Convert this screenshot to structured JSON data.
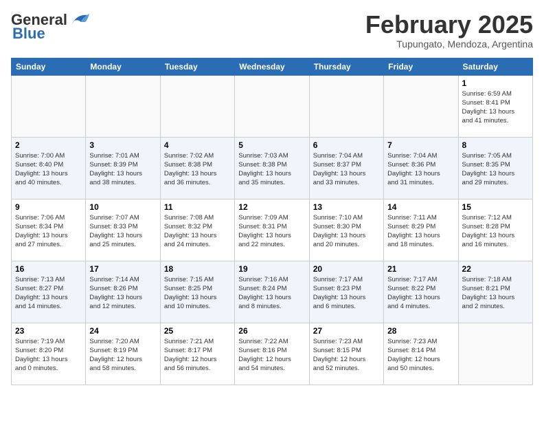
{
  "header": {
    "logo_general": "General",
    "logo_blue": "Blue",
    "title": "February 2025",
    "subtitle": "Tupungato, Mendoza, Argentina"
  },
  "days_of_week": [
    "Sunday",
    "Monday",
    "Tuesday",
    "Wednesday",
    "Thursday",
    "Friday",
    "Saturday"
  ],
  "weeks": [
    {
      "days": [
        {
          "num": "",
          "info": ""
        },
        {
          "num": "",
          "info": ""
        },
        {
          "num": "",
          "info": ""
        },
        {
          "num": "",
          "info": ""
        },
        {
          "num": "",
          "info": ""
        },
        {
          "num": "",
          "info": ""
        },
        {
          "num": "1",
          "info": "Sunrise: 6:59 AM\nSunset: 8:41 PM\nDaylight: 13 hours\nand 41 minutes."
        }
      ]
    },
    {
      "days": [
        {
          "num": "2",
          "info": "Sunrise: 7:00 AM\nSunset: 8:40 PM\nDaylight: 13 hours\nand 40 minutes."
        },
        {
          "num": "3",
          "info": "Sunrise: 7:01 AM\nSunset: 8:39 PM\nDaylight: 13 hours\nand 38 minutes."
        },
        {
          "num": "4",
          "info": "Sunrise: 7:02 AM\nSunset: 8:38 PM\nDaylight: 13 hours\nand 36 minutes."
        },
        {
          "num": "5",
          "info": "Sunrise: 7:03 AM\nSunset: 8:38 PM\nDaylight: 13 hours\nand 35 minutes."
        },
        {
          "num": "6",
          "info": "Sunrise: 7:04 AM\nSunset: 8:37 PM\nDaylight: 13 hours\nand 33 minutes."
        },
        {
          "num": "7",
          "info": "Sunrise: 7:04 AM\nSunset: 8:36 PM\nDaylight: 13 hours\nand 31 minutes."
        },
        {
          "num": "8",
          "info": "Sunrise: 7:05 AM\nSunset: 8:35 PM\nDaylight: 13 hours\nand 29 minutes."
        }
      ]
    },
    {
      "days": [
        {
          "num": "9",
          "info": "Sunrise: 7:06 AM\nSunset: 8:34 PM\nDaylight: 13 hours\nand 27 minutes."
        },
        {
          "num": "10",
          "info": "Sunrise: 7:07 AM\nSunset: 8:33 PM\nDaylight: 13 hours\nand 25 minutes."
        },
        {
          "num": "11",
          "info": "Sunrise: 7:08 AM\nSunset: 8:32 PM\nDaylight: 13 hours\nand 24 minutes."
        },
        {
          "num": "12",
          "info": "Sunrise: 7:09 AM\nSunset: 8:31 PM\nDaylight: 13 hours\nand 22 minutes."
        },
        {
          "num": "13",
          "info": "Sunrise: 7:10 AM\nSunset: 8:30 PM\nDaylight: 13 hours\nand 20 minutes."
        },
        {
          "num": "14",
          "info": "Sunrise: 7:11 AM\nSunset: 8:29 PM\nDaylight: 13 hours\nand 18 minutes."
        },
        {
          "num": "15",
          "info": "Sunrise: 7:12 AM\nSunset: 8:28 PM\nDaylight: 13 hours\nand 16 minutes."
        }
      ]
    },
    {
      "days": [
        {
          "num": "16",
          "info": "Sunrise: 7:13 AM\nSunset: 8:27 PM\nDaylight: 13 hours\nand 14 minutes."
        },
        {
          "num": "17",
          "info": "Sunrise: 7:14 AM\nSunset: 8:26 PM\nDaylight: 13 hours\nand 12 minutes."
        },
        {
          "num": "18",
          "info": "Sunrise: 7:15 AM\nSunset: 8:25 PM\nDaylight: 13 hours\nand 10 minutes."
        },
        {
          "num": "19",
          "info": "Sunrise: 7:16 AM\nSunset: 8:24 PM\nDaylight: 13 hours\nand 8 minutes."
        },
        {
          "num": "20",
          "info": "Sunrise: 7:17 AM\nSunset: 8:23 PM\nDaylight: 13 hours\nand 6 minutes."
        },
        {
          "num": "21",
          "info": "Sunrise: 7:17 AM\nSunset: 8:22 PM\nDaylight: 13 hours\nand 4 minutes."
        },
        {
          "num": "22",
          "info": "Sunrise: 7:18 AM\nSunset: 8:21 PM\nDaylight: 13 hours\nand 2 minutes."
        }
      ]
    },
    {
      "days": [
        {
          "num": "23",
          "info": "Sunrise: 7:19 AM\nSunset: 8:20 PM\nDaylight: 13 hours\nand 0 minutes."
        },
        {
          "num": "24",
          "info": "Sunrise: 7:20 AM\nSunset: 8:19 PM\nDaylight: 12 hours\nand 58 minutes."
        },
        {
          "num": "25",
          "info": "Sunrise: 7:21 AM\nSunset: 8:17 PM\nDaylight: 12 hours\nand 56 minutes."
        },
        {
          "num": "26",
          "info": "Sunrise: 7:22 AM\nSunset: 8:16 PM\nDaylight: 12 hours\nand 54 minutes."
        },
        {
          "num": "27",
          "info": "Sunrise: 7:23 AM\nSunset: 8:15 PM\nDaylight: 12 hours\nand 52 minutes."
        },
        {
          "num": "28",
          "info": "Sunrise: 7:23 AM\nSunset: 8:14 PM\nDaylight: 12 hours\nand 50 minutes."
        },
        {
          "num": "",
          "info": ""
        }
      ]
    }
  ]
}
